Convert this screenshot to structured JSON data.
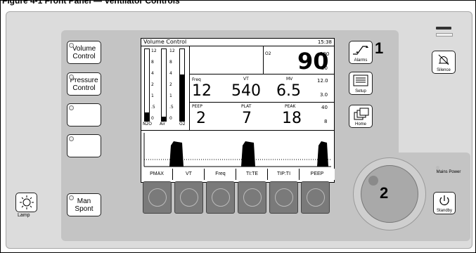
{
  "caption": "Figure 4-1  Front Panel — Ventilator Controls",
  "mode_buttons": [
    {
      "label_1": "Volume",
      "label_2": "Control"
    },
    {
      "label_1": "Pressure",
      "label_2": "Control"
    },
    {
      "label_1": "",
      "label_2": ""
    },
    {
      "label_1": "",
      "label_2": ""
    }
  ],
  "man_spont": {
    "label_1": "Man",
    "label_2": "Spont"
  },
  "lamp": {
    "label": "Lamp"
  },
  "screen": {
    "title": "Volume Control",
    "time": "15:38",
    "o2": {
      "label": "O2",
      "value": "90",
      "high": "100",
      "low": "20"
    },
    "freq": {
      "label": "Freq",
      "value": "12"
    },
    "vt": {
      "label": "VT",
      "value": "540"
    },
    "mv": {
      "label": "MV",
      "value": "6.5",
      "high": "12.0",
      "low": "3.0"
    },
    "peep": {
      "label": "PEEP",
      "value": "2"
    },
    "plat": {
      "label": "PLAT",
      "value": "7"
    },
    "peak": {
      "label": "PEAK",
      "value": "18",
      "high": "40",
      "low": "8"
    },
    "flow_labels": [
      "N2O",
      "Air",
      "O2"
    ],
    "scale_left": [
      "12",
      "8",
      "4",
      "2",
      "1",
      ".5",
      "0"
    ],
    "scale_mid": [
      "12",
      "8",
      "4",
      "2",
      "1",
      ".5",
      "0"
    ],
    "softkeys": [
      "PMAX",
      "VT",
      "Freq",
      "TI:TE",
      "TIP:TI",
      "PEEP"
    ]
  },
  "right_buttons": {
    "alarms": "Alarms",
    "setup": "Setup",
    "home": "Home",
    "silence": "Silence",
    "mains": "Mains Power",
    "standby": "Standby"
  },
  "callouts": {
    "one": "1",
    "two": "2"
  }
}
